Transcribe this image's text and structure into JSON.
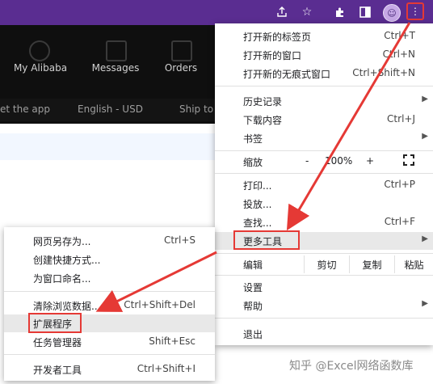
{
  "browser": {
    "icons": [
      "share-icon",
      "star-icon",
      "extension-puzzle-icon",
      "sidebar-icon",
      "profile-avatar-icon",
      "kebab-menu-icon"
    ],
    "accent": "#5a2d91",
    "highlight_color": "#e53935"
  },
  "site": {
    "nav": [
      "My Alibaba",
      "Messages",
      "Orders"
    ],
    "subbar": [
      "et the app",
      "English - USD",
      "Ship to"
    ]
  },
  "menu": {
    "new_tab": {
      "label": "打开新的标签页",
      "shortcut": "Ctrl+T"
    },
    "new_window": {
      "label": "打开新的窗口",
      "shortcut": "Ctrl+N"
    },
    "incognito": {
      "label": "打开新的无痕式窗口",
      "shortcut": "Ctrl+Shift+N"
    },
    "history": {
      "label": "历史记录"
    },
    "downloads": {
      "label": "下载内容",
      "shortcut": "Ctrl+J"
    },
    "bookmarks": {
      "label": "书签"
    },
    "zoom": {
      "label": "缩放",
      "minus": "-",
      "value": "100%",
      "plus": "+"
    },
    "print": {
      "label": "打印...",
      "shortcut": "Ctrl+P"
    },
    "cast": {
      "label": "投放..."
    },
    "find": {
      "label": "查找...",
      "shortcut": "Ctrl+F"
    },
    "more_tools": {
      "label": "更多工具"
    },
    "edit": {
      "label": "编辑",
      "cut": "剪切",
      "copy": "复制",
      "paste": "粘贴"
    },
    "settings": {
      "label": "设置"
    },
    "help": {
      "label": "帮助"
    },
    "exit": {
      "label": "退出"
    }
  },
  "submenu": {
    "save_page": {
      "label": "网页另存为...",
      "shortcut": "Ctrl+S"
    },
    "create_shortcut": {
      "label": "创建快捷方式..."
    },
    "name_window": {
      "label": "为窗口命名..."
    },
    "clear_data": {
      "label": "清除浏览数据...",
      "shortcut": "Ctrl+Shift+Del"
    },
    "extensions": {
      "label": "扩展程序"
    },
    "task_manager": {
      "label": "任务管理器",
      "shortcut": "Shift+Esc"
    },
    "dev_tools": {
      "label": "开发者工具",
      "shortcut": "Ctrl+Shift+I"
    }
  },
  "watermark": "知乎 @Excel网络函数库"
}
